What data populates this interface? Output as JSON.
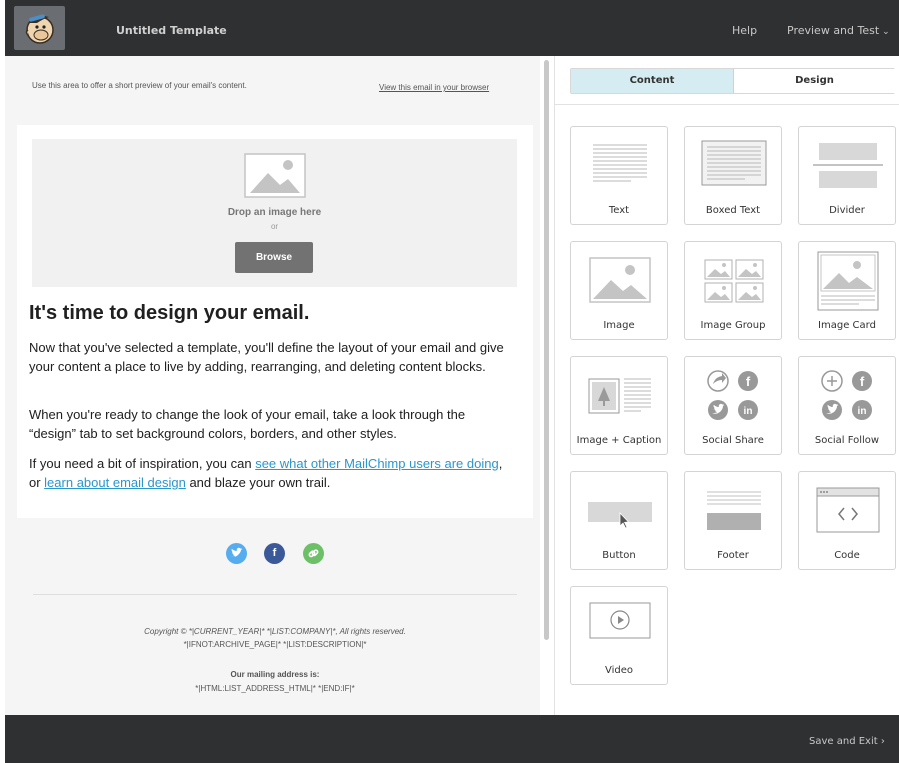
{
  "header": {
    "template_title": "Untitled Template",
    "help_label": "Help",
    "preview_label": "Preview and Test",
    "preview_chevron": "⌄"
  },
  "email": {
    "preheader_text": "Use this area to offer a short preview of your email's content.",
    "view_in_browser": "View this email in your browser",
    "image_drop": {
      "drop_text": "Drop an image here",
      "or_text": "or",
      "browse_label": "Browse"
    },
    "headline": "It's time to design your email.",
    "paragraph1": "Now that you've selected a template, you'll define the layout of your email and give your content a place to live by adding, rearranging, and deleting content blocks.",
    "paragraph2": "When you're ready to change the look of your email, take a look through the “design” tab to set background colors, borders, and other styles.",
    "paragraph3": {
      "prefix": "If you need a bit of inspiration, you can ",
      "link1": "see what other MailChimp users are doing",
      "middle": ", or ",
      "link2": "learn about email design",
      "suffix": " and blaze your own trail."
    },
    "social_icons": [
      "twitter-icon",
      "facebook-icon",
      "link-icon"
    ],
    "footer": {
      "copyright": "Copyright © *|CURRENT_YEAR|* *|LIST:COMPANY|*, All rights reserved.",
      "archive": "*|IFNOT:ARCHIVE_PAGE|* *|LIST:DESCRIPTION|*",
      "address_label": "Our mailing address is:",
      "address_value": "*|HTML:LIST_ADDRESS_HTML|* *|END:IF|*"
    }
  },
  "panel": {
    "tabs": [
      {
        "label": "Content",
        "active": true
      },
      {
        "label": "Design",
        "active": false
      }
    ],
    "blocks": [
      {
        "label": "Text",
        "icon": "text-block-icon"
      },
      {
        "label": "Boxed Text",
        "icon": "boxed-text-icon"
      },
      {
        "label": "Divider",
        "icon": "divider-block-icon"
      },
      {
        "label": "Image",
        "icon": "image-block-icon"
      },
      {
        "label": "Image Group",
        "icon": "image-group-icon"
      },
      {
        "label": "Image Card",
        "icon": "image-card-icon"
      },
      {
        "label": "Image + Caption",
        "icon": "image-caption-icon"
      },
      {
        "label": "Social Share",
        "icon": "social-share-icon"
      },
      {
        "label": "Social Follow",
        "icon": "social-follow-icon"
      },
      {
        "label": "Button",
        "icon": "button-block-icon"
      },
      {
        "label": "Footer",
        "icon": "footer-block-icon"
      },
      {
        "label": "Code",
        "icon": "code-block-icon"
      },
      {
        "label": "Video",
        "icon": "video-block-icon"
      }
    ]
  },
  "bottom_bar": {
    "save_exit_label": "Save and Exit",
    "save_exit_chevron": "›"
  },
  "colors": {
    "topbar": "#2f3031",
    "active_tab": "#d6ecf3",
    "link": "#2a96cc",
    "browse_button": "#727272"
  }
}
